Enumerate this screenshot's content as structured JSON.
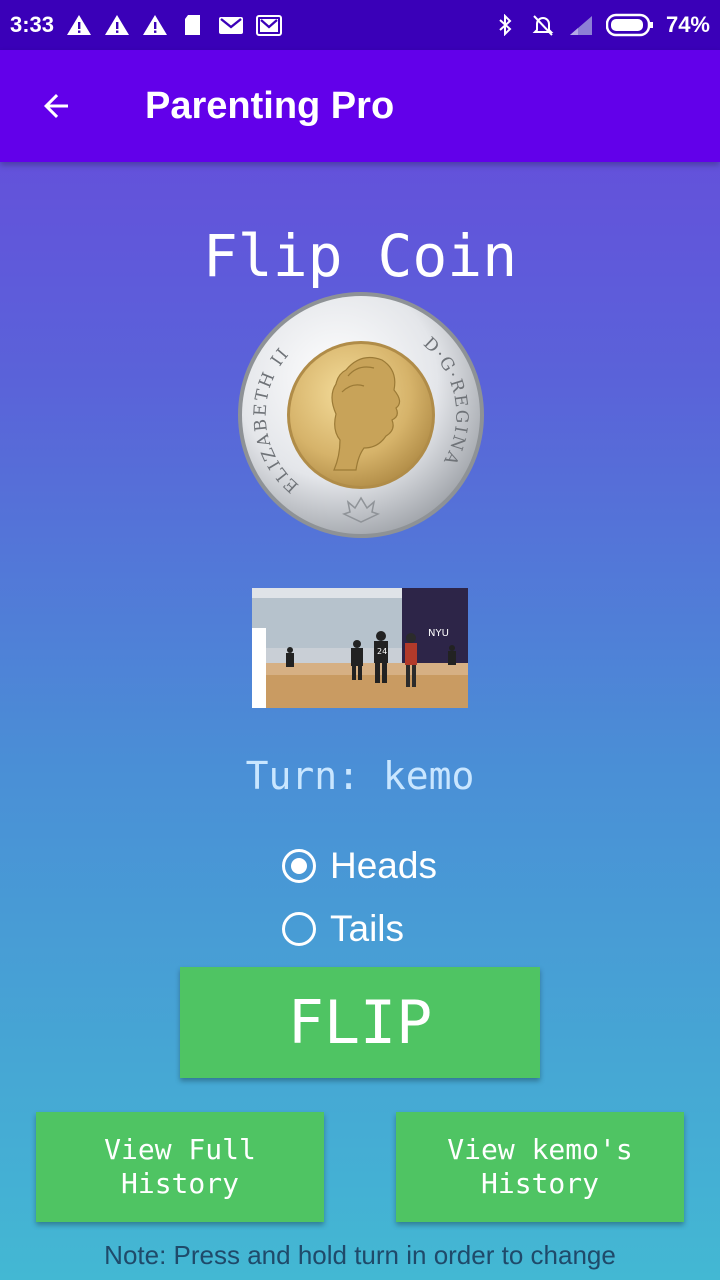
{
  "status_bar": {
    "time": "3:33",
    "battery": "74%",
    "left_icons": [
      "warning-icon",
      "warning-icon",
      "warning-icon",
      "sd-card-icon",
      "gmail-icon",
      "gmail-icon"
    ],
    "right_icons": [
      "bluetooth-icon",
      "notifications-off-icon",
      "signal-icon",
      "battery-icon"
    ]
  },
  "app_bar": {
    "title": "Parenting Pro",
    "back_icon": "arrow-back-icon"
  },
  "main": {
    "title": "Flip Coin",
    "coin_text_left": "ELIZABETH II",
    "coin_text_right": "D·G·REGINA",
    "turn_label": "Turn: kemo",
    "options": [
      {
        "label": "Heads",
        "checked": true
      },
      {
        "label": "Tails",
        "checked": false
      }
    ],
    "flip_label": "FLIP",
    "full_history_label": "View Full\nHistory",
    "user_history_label": "View kemo's\nHistory",
    "note": "Note: Press and hold turn in order to change"
  },
  "photo": {
    "jersey_number": "24",
    "banner_text": "NYU"
  },
  "colors": {
    "status_bar": "#3a00b8",
    "app_bar": "#6200ea",
    "button": "#4fc463",
    "turn_text": "#c9e6ff",
    "note_text": "#1f4a6a"
  }
}
